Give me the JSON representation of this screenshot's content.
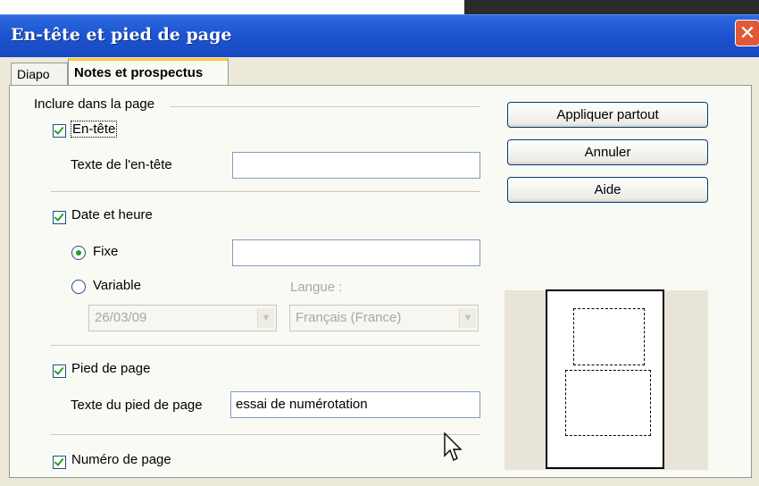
{
  "window": {
    "title": "En-tête et pied de page",
    "close_glyph": "✕"
  },
  "tabs": [
    {
      "label": "Diapo",
      "active": false
    },
    {
      "label": "Notes et prospectus",
      "active": true
    }
  ],
  "group": {
    "label": "Inclure dans la page"
  },
  "header": {
    "checkbox_label": "En-tête",
    "checked": true,
    "text_label": "Texte de l'en-tête",
    "text_value": ""
  },
  "datetime": {
    "checkbox_label": "Date et heure",
    "checked": true,
    "fixed_label": "Fixe",
    "fixed_selected": true,
    "fixed_value": "",
    "variable_label": "Variable",
    "variable_selected": false,
    "language_label": "Langue :",
    "format_value": "26/03/09",
    "language_value": "Français (France)"
  },
  "footer": {
    "checkbox_label": "Pied de page",
    "checked": true,
    "text_label": "Texte du pied de page",
    "text_value": "essai de numérotation"
  },
  "page_number": {
    "checkbox_label": "Numéro de page",
    "checked": true
  },
  "buttons": {
    "apply_all": "Appliquer partout",
    "cancel": "Annuler",
    "help": "Aide"
  },
  "colors": {
    "titlebar": "#1d55d0",
    "active_tab_accent": "#ffc83c",
    "check": "#21a121"
  }
}
